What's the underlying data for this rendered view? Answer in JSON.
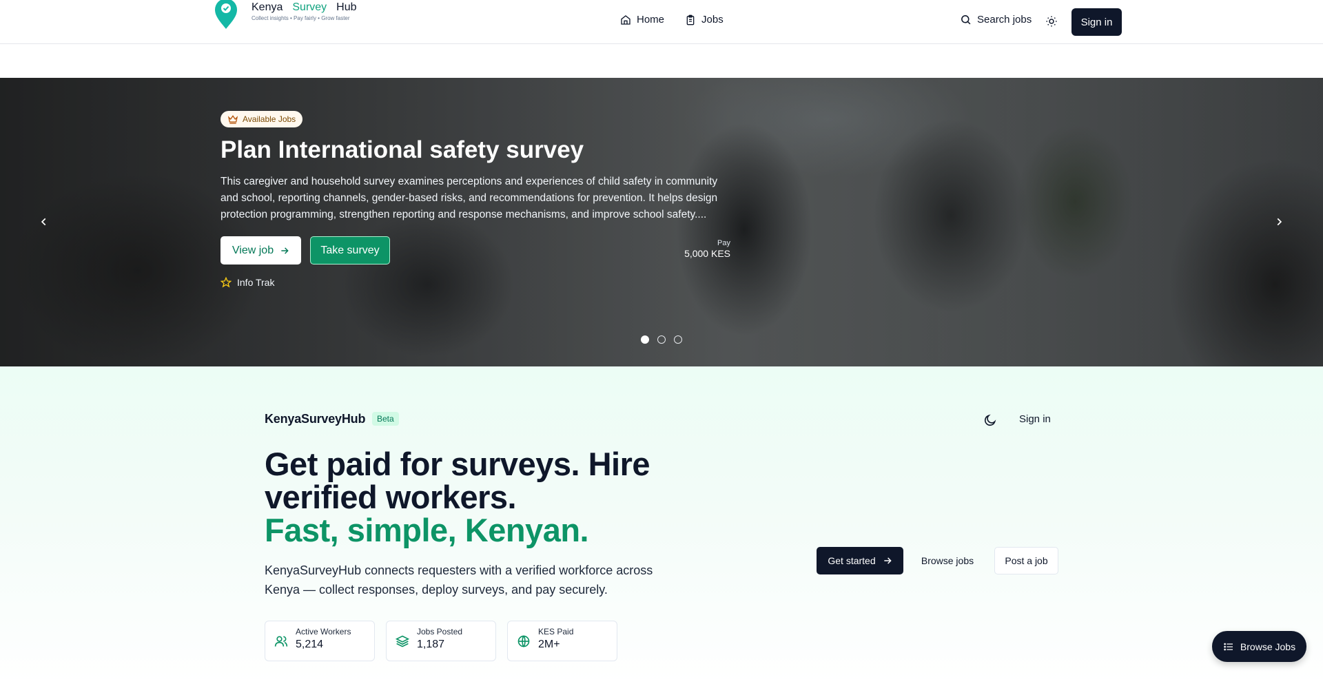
{
  "header": {
    "brand": {
      "word1": "Kenya",
      "word2": "Survey",
      "word3": "Hub",
      "tagline": "Collect insights • Pay fairly • Grow faster"
    },
    "nav": [
      {
        "label": "Home",
        "icon": "home-icon"
      },
      {
        "label": "Jobs",
        "icon": "clipboard-icon"
      }
    ],
    "search_label": "Search jobs",
    "signin_label": "Sign in"
  },
  "hero": {
    "badge": "Available Jobs",
    "title": "Plan International safety survey",
    "description": "This caregiver and household survey examines perceptions and experiences of child safety in community and school, reporting channels, gender-based risks, and recommendations for prevention. It helps design protection programming, strengthen reporting and response mechanisms, and improve school safety....",
    "view_label": "View job",
    "take_label": "Take survey",
    "pay_label": "Pay",
    "pay_value": "5,000 KES",
    "company": "Info Trak",
    "slides_total": 3,
    "active_slide": 1
  },
  "landing": {
    "site_name": "KenyaSurveyHub",
    "beta": "Beta",
    "signin_label": "Sign in",
    "headline_line1": "Get paid for surveys. Hire verified workers.",
    "headline_line2": "Fast, simple, Kenyan.",
    "lead": "KenyaSurveyHub connects requesters with a verified workforce across Kenya — collect responses, deploy surveys, and pay securely.",
    "stats": [
      {
        "label": "Active Workers",
        "value": "5,214",
        "icon": "users-icon"
      },
      {
        "label": "Jobs Posted",
        "value": "1,187",
        "icon": "layers-icon"
      },
      {
        "label": "KES Paid",
        "value": "2M+",
        "icon": "globe-icon"
      }
    ],
    "get_started_label": "Get started",
    "browse_label": "Browse jobs",
    "post_label": "Post a job"
  },
  "fab_label": "Browse Jobs",
  "colors": {
    "accent": "#0d9466",
    "dark": "#0f172a",
    "brand_pin": "#14b8a6"
  }
}
